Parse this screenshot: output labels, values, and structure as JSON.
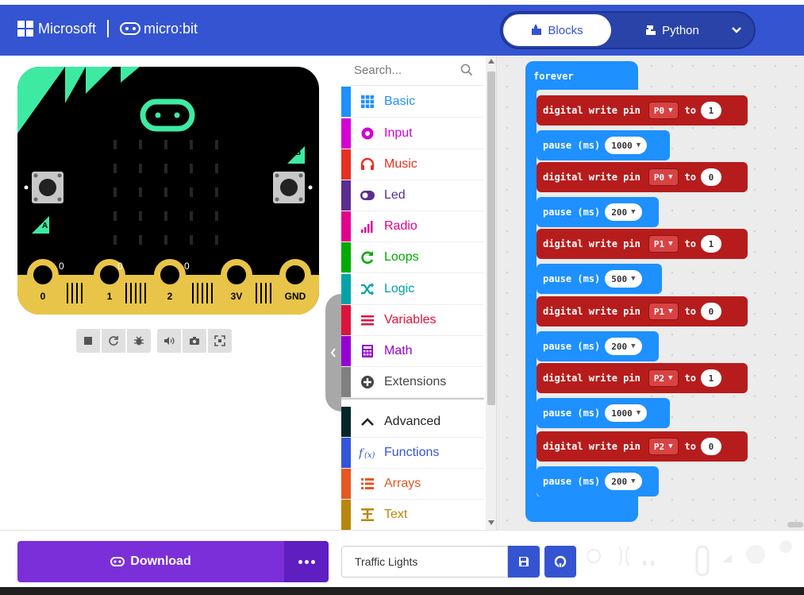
{
  "header": {
    "brand_microsoft": "Microsoft",
    "brand_microbit": "micro:bit",
    "editor_toggle": {
      "blocks_label": "Blocks",
      "python_label": "Python"
    },
    "colors": {
      "header_bg": "#3454d1"
    }
  },
  "simulator": {
    "buttons": {
      "a": "A",
      "b": "B"
    },
    "pins": [
      "0",
      "1",
      "2",
      "3V",
      "GND"
    ],
    "pin_readouts": [
      "0",
      "0",
      "0"
    ],
    "controls": [
      "stop-icon",
      "restart-icon",
      "debug-icon",
      "mute-icon",
      "screenshot-icon",
      "fullscreen-icon"
    ]
  },
  "toolbox": {
    "search_placeholder": "Search...",
    "categories": [
      {
        "label": "Basic",
        "color": "#1e90ff",
        "icon": "grid-icon"
      },
      {
        "label": "Input",
        "color": "#d400d4",
        "icon": "input-icon"
      },
      {
        "label": "Music",
        "color": "#e63022",
        "icon": "headphones-icon"
      },
      {
        "label": "Led",
        "color": "#5c2d91",
        "icon": "toggle-icon"
      },
      {
        "label": "Radio",
        "color": "#e3008c",
        "icon": "signal-icon"
      },
      {
        "label": "Loops",
        "color": "#00aa00",
        "icon": "loop-icon"
      },
      {
        "label": "Logic",
        "color": "#00a4a6",
        "icon": "shuffle-icon"
      },
      {
        "label": "Variables",
        "color": "#dc143c",
        "icon": "lines-icon"
      },
      {
        "label": "Math",
        "color": "#9400d3",
        "icon": "calculator-icon"
      },
      {
        "label": "Extensions",
        "color": "#808080",
        "icon": "plus-circle-icon"
      },
      {
        "label": "Advanced",
        "color": "#00272b",
        "icon": "chevron-up-icon"
      },
      {
        "label": "Functions",
        "color": "#3455db",
        "icon": "function-icon"
      },
      {
        "label": "Arrays",
        "color": "#e65722",
        "icon": "list-icon"
      },
      {
        "label": "Text",
        "color": "#b8860b",
        "icon": "text-icon"
      }
    ]
  },
  "workspace": {
    "forever_label": "forever",
    "digital_write_label": "digital write pin",
    "to_label": "to",
    "pause_label": "pause (ms)",
    "blocks": [
      {
        "type": "digital_write",
        "pin": "P0",
        "value": "1"
      },
      {
        "type": "pause",
        "ms": "1000"
      },
      {
        "type": "digital_write",
        "pin": "P0",
        "value": "0"
      },
      {
        "type": "pause",
        "ms": "200"
      },
      {
        "type": "digital_write",
        "pin": "P1",
        "value": "1"
      },
      {
        "type": "pause",
        "ms": "500"
      },
      {
        "type": "digital_write",
        "pin": "P1",
        "value": "0"
      },
      {
        "type": "pause",
        "ms": "200"
      },
      {
        "type": "digital_write",
        "pin": "P2",
        "value": "1"
      },
      {
        "type": "pause",
        "ms": "1000"
      },
      {
        "type": "digital_write",
        "pin": "P2",
        "value": "0"
      },
      {
        "type": "pause",
        "ms": "200"
      }
    ],
    "colors": {
      "led_block": "#b71c1c",
      "basic_block": "#1e90ff"
    }
  },
  "footer": {
    "download_label": "Download",
    "project_name": "Traffic Lights"
  }
}
